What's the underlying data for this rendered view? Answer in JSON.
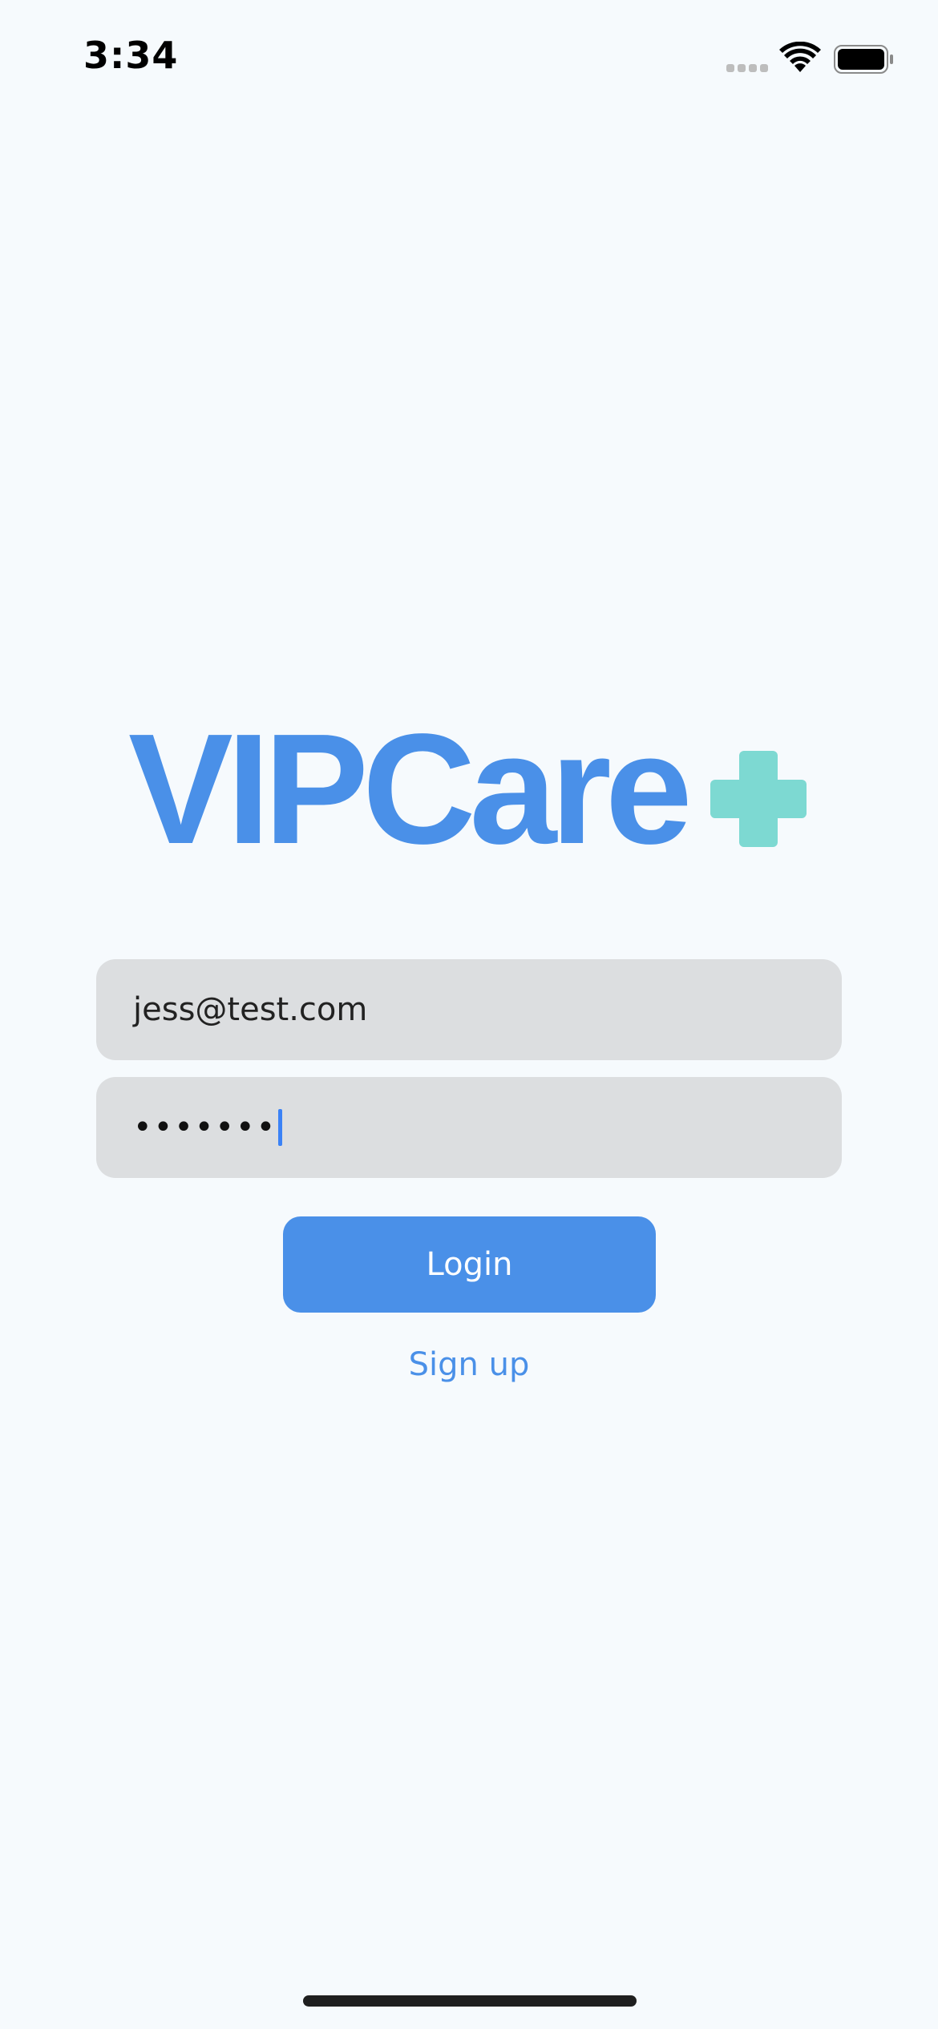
{
  "status_bar": {
    "time": "3:34"
  },
  "logo": {
    "text": "VIPCare",
    "text_color": "#4a90e8",
    "cross_color": "#7dd9d2",
    "icon": "medical-cross-icon"
  },
  "login_form": {
    "email_value": "jess@test.com",
    "password_masked": "•••••••",
    "login_label": "Login",
    "signup_label": "Sign up"
  },
  "colors": {
    "background": "#f6fafd",
    "accent": "#4a90e8",
    "field_background": "#dcdee0"
  }
}
